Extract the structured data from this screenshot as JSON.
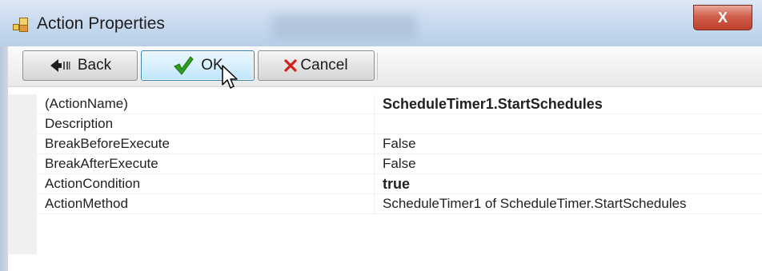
{
  "window": {
    "title": "Action Properties",
    "close_label": "X"
  },
  "toolbar": {
    "back_label": "Back",
    "ok_label": "OK",
    "cancel_label": "Cancel"
  },
  "properties": [
    {
      "name": "(ActionName)",
      "value": "ScheduleTimer1.StartSchedules",
      "bold": true
    },
    {
      "name": "Description",
      "value": "",
      "bold": false
    },
    {
      "name": "BreakBeforeExecute",
      "value": "False",
      "bold": false
    },
    {
      "name": "BreakAfterExecute",
      "value": "False",
      "bold": false
    },
    {
      "name": "ActionCondition",
      "value": "true",
      "bold": true
    },
    {
      "name": "ActionMethod",
      "value": "ScheduleTimer1 of ScheduleTimer.StartSchedules",
      "bold": false
    }
  ],
  "colors": {
    "ok_check": "#2e9e1f",
    "cancel_x": "#d4201c",
    "close_button": "#c8452f"
  }
}
